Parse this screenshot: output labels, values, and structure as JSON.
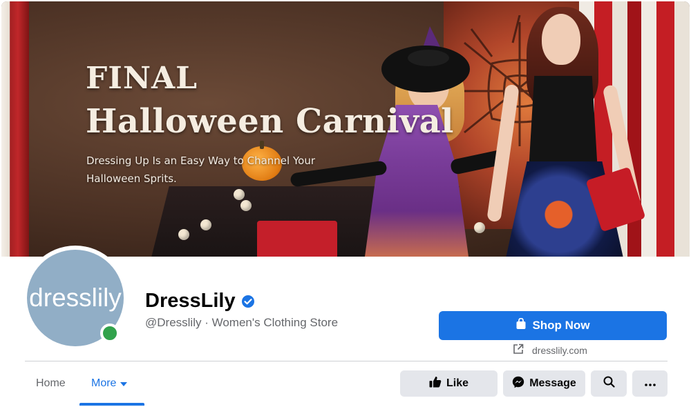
{
  "cover": {
    "title_line1": "FINAL",
    "title_line2": "Halloween Carnival",
    "subtitle": "Dressing Up Is an Easy Way to Channel Your Halloween Sprits."
  },
  "profile": {
    "avatar_text": "dresslily",
    "name": "DressLily",
    "verified": true,
    "handle_category": "@Dresslily · Women's Clothing Store",
    "online": true
  },
  "actions": {
    "shop_now_label": "Shop Now",
    "website": "dresslily.com",
    "like_label": "Like",
    "message_label": "Message"
  },
  "nav": {
    "tabs": [
      {
        "label": "Home",
        "active": false
      },
      {
        "label": "More",
        "active": true
      }
    ]
  },
  "icons": {
    "verified": "verified-badge-icon",
    "shop": "shopping-bag-icon",
    "external_link": "external-link-icon",
    "like": "thumbs-up-icon",
    "message": "messenger-icon",
    "search": "search-icon",
    "more": "more-dots-icon",
    "dropdown": "caret-down-icon"
  },
  "colors": {
    "accent": "#1b74e4",
    "button_gray": "#e4e6eb",
    "online": "#31a24c",
    "avatar_bg": "#91aec6"
  }
}
